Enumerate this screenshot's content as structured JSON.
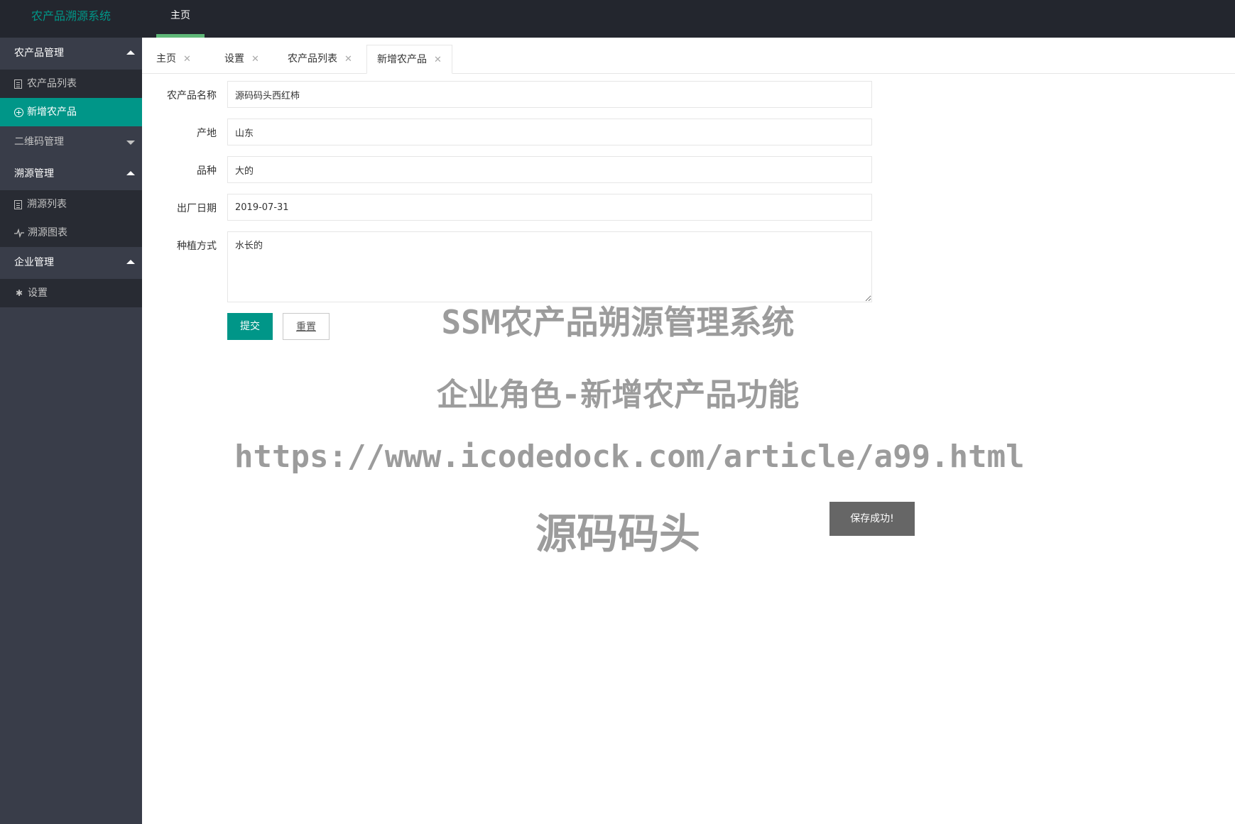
{
  "header": {
    "logo": "农产品溯源系统",
    "nav_home": "主页"
  },
  "sidebar": {
    "groups": [
      {
        "title": "农产品管理",
        "expanded": true,
        "items": [
          {
            "label": "农产品列表",
            "icon": "document-icon"
          },
          {
            "label": "新增农产品",
            "icon": "plus-circle-icon",
            "active": true
          }
        ]
      },
      {
        "title": "二维码管理",
        "expanded": false,
        "items": []
      },
      {
        "title": "溯源管理",
        "expanded": true,
        "items": [
          {
            "label": "溯源列表",
            "icon": "document-icon"
          },
          {
            "label": "溯源图表",
            "icon": "pulse-icon"
          }
        ]
      },
      {
        "title": "企业管理",
        "expanded": true,
        "items": [
          {
            "label": "设置",
            "icon": "gear-icon"
          }
        ]
      }
    ]
  },
  "tabs": [
    {
      "label": "主页"
    },
    {
      "label": "设置"
    },
    {
      "label": "农产品列表"
    },
    {
      "label": "新增农产品",
      "active": true
    }
  ],
  "form": {
    "name_label": "农产品名称",
    "name_value": "源码码头西红柿",
    "origin_label": "产地",
    "origin_value": "山东",
    "variety_label": "品种",
    "variety_value": "大的",
    "date_label": "出厂日期",
    "date_value": "2019-07-31",
    "method_label": "种植方式",
    "method_value": "水长的",
    "submit_label": "提交",
    "reset_label": "重置"
  },
  "watermark": {
    "line1": "SSM农产品朔源管理系统",
    "line2": "企业角色-新增农产品功能",
    "line3": "https://www.icodedock.com/article/a99.html",
    "line4": "源码码头"
  },
  "toast": {
    "message": "保存成功!"
  },
  "colors": {
    "header_bg": "#23262e",
    "sidebar_bg": "#393d49",
    "submenu_bg": "#282b33",
    "accent": "#009688",
    "nav_underline": "#5fb878",
    "toast_bg": "#666666"
  }
}
